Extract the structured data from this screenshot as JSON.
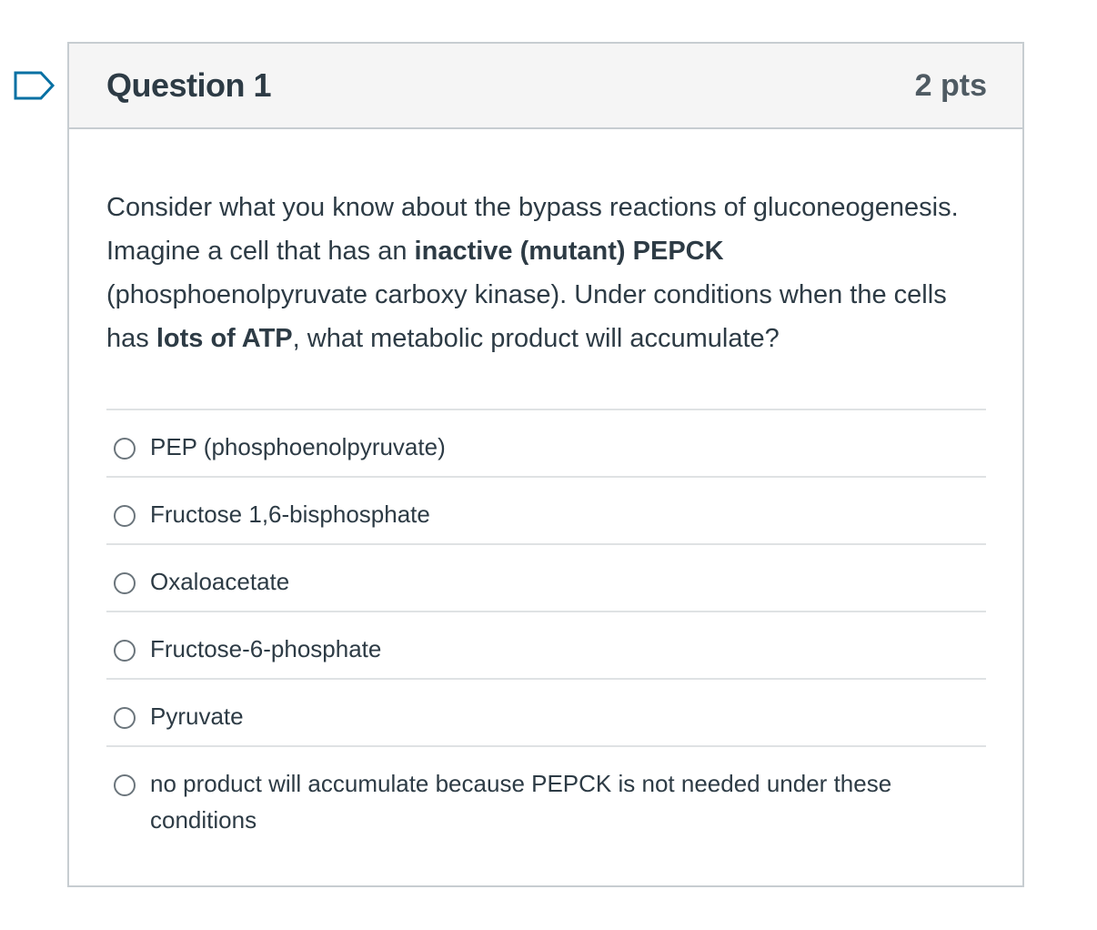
{
  "question": {
    "title": "Question 1",
    "points": "2 pts",
    "flag_icon": "bookmark-flag-icon",
    "text_parts": {
      "p1": "Consider what you know about the bypass reactions of gluconeogenesis. Imagine a cell that has an ",
      "b1": "inactive (mutant) PEPCK",
      "p2": " (phosphoenolpyruvate carboxy kinase). Under conditions when the cells has ",
      "b2": "lots of ATP",
      "p3": ", what metabolic product will accumulate?"
    },
    "answers": [
      {
        "label": "PEP (phosphoenolpyruvate)"
      },
      {
        "label": "Fructose 1,6-bisphosphate"
      },
      {
        "label": "Oxaloacetate"
      },
      {
        "label": "Fructose-6-phosphate"
      },
      {
        "label": "Pyruvate"
      },
      {
        "label": "no product will accumulate because PEPCK is not needed under these conditions"
      }
    ]
  },
  "colors": {
    "accent": "#0770a3",
    "border": "#c7cdd1",
    "header_bg": "#f5f5f5",
    "text": "#2d3b45"
  }
}
